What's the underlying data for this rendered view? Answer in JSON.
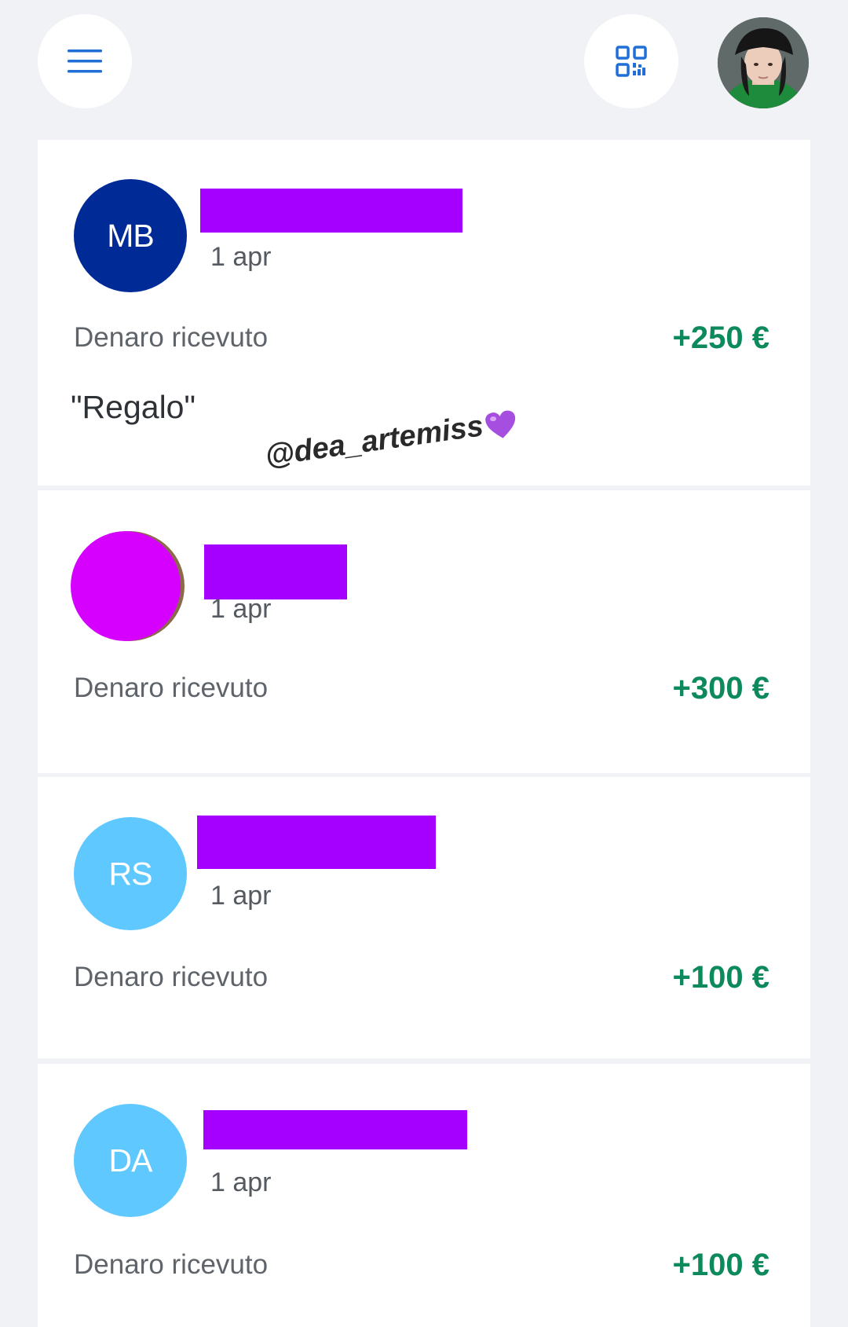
{
  "header": {
    "menu_icon": "hamburger-menu-icon",
    "qr_icon": "qr-code-icon",
    "profile_icon": "user-profile-photo"
  },
  "transactions": [
    {
      "initials": "MB",
      "avatar_color": "#002b96",
      "date": "1 apr",
      "type": "Denaro ricevuto",
      "amount": "+250 €",
      "note": "\"Regalo\""
    },
    {
      "initials": "",
      "avatar_color": "#d600ff",
      "date": "1 apr",
      "type": "Denaro ricevuto",
      "amount": "+300 €"
    },
    {
      "initials": "RS",
      "avatar_color": "#5fc8ff",
      "date": "1 apr",
      "type": "Denaro ricevuto",
      "amount": "+100 €"
    },
    {
      "initials": "DA",
      "avatar_color": "#5fc8ff",
      "date": "1 apr",
      "type": "Denaro ricevuto",
      "amount": "+100 €"
    }
  ],
  "watermark": "@dea_artemiss",
  "colors": {
    "accent_blue": "#1f6fd6",
    "amount_green": "#0c8a5c",
    "redaction_purple": "#a500ff"
  }
}
